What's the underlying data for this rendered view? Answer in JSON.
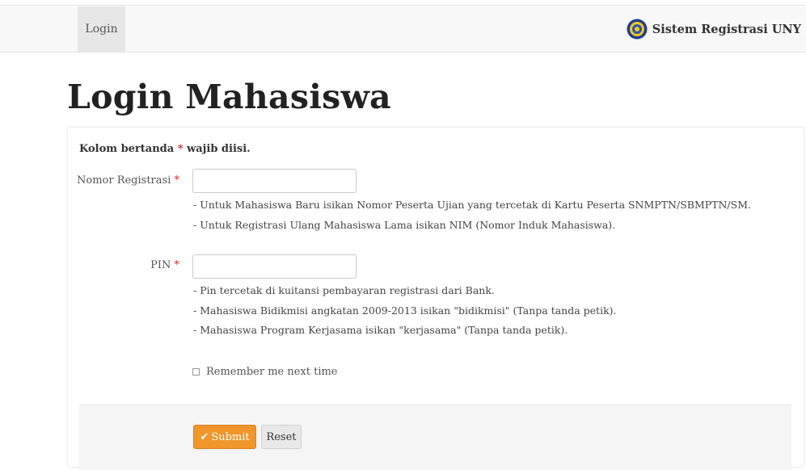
{
  "nav": {
    "login_label": "Login",
    "brand_text": "Sistem Registrasi UNY",
    "brand_logo_icon": "university-seal-icon"
  },
  "page": {
    "title": "Login Mahasiswa"
  },
  "form": {
    "required_note_prefix": "Kolom bertanda",
    "required_mark": "*",
    "required_note_suffix": "wajib diisi.",
    "fields": {
      "registration": {
        "label": "Nomor Registrasi",
        "value": "",
        "hints": [
          "- Untuk Mahasiswa Baru isikan Nomor Peserta Ujian yang tercetak di Kartu Peserta SNMPTN/SBMPTN/SM.",
          "- Untuk Registrasi Ulang Mahasiswa Lama isikan NIM (Nomor Induk Mahasiswa)."
        ]
      },
      "pin": {
        "label": "PIN",
        "value": "",
        "hints": [
          "- Pin tercetak di kuitansi pembayaran registrasi dari Bank.",
          "- Mahasiswa Bidikmisi angkatan 2009-2013 isikan \"bidikmisi\" (Tanpa tanda petik).",
          "- Mahasiswa Program Kerjasama isikan \"kerjasama\" (Tanpa tanda petik)."
        ]
      }
    },
    "remember_label": "Remember me next time",
    "submit_label": "Submit",
    "reset_label": "Reset"
  },
  "colors": {
    "submit_bg": "#f0962a",
    "required": "#c9302c",
    "navbar_bg": "#f8f8f8"
  }
}
